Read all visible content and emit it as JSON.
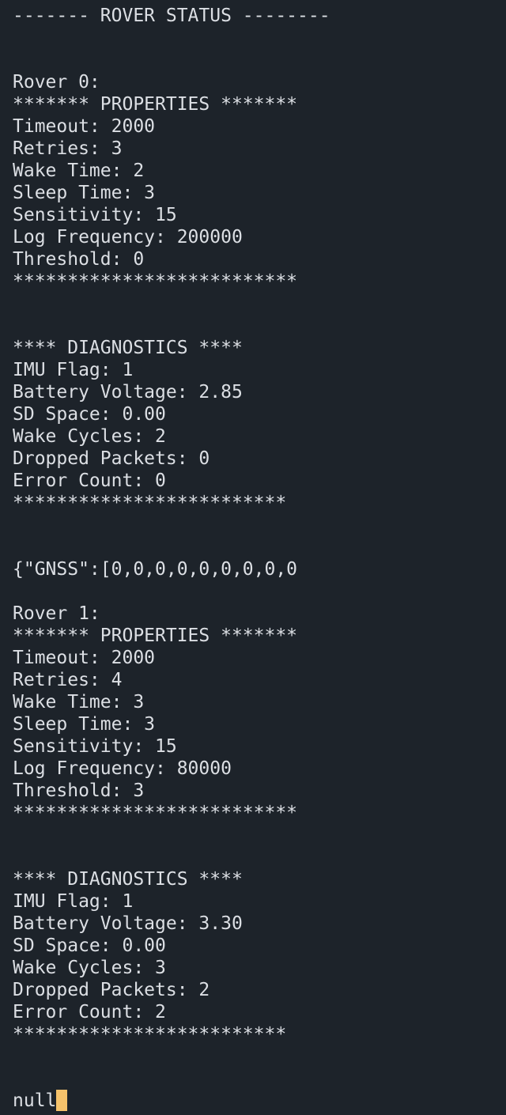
{
  "terminal": {
    "lines": [
      "------- ROVER STATUS --------",
      "",
      "",
      "Rover 0:",
      "******* PROPERTIES *******",
      "Timeout: 2000",
      "Retries: 3",
      "Wake Time: 2",
      "Sleep Time: 3",
      "Sensitivity: 15",
      "Log Frequency: 200000",
      "Threshold: 0",
      "**************************",
      "",
      "",
      "**** DIAGNOSTICS ****",
      "IMU Flag: 1",
      "Battery Voltage: 2.85",
      "SD Space: 0.00",
      "Wake Cycles: 2",
      "Dropped Packets: 0",
      "Error Count: 0",
      "*************************",
      "",
      "",
      "{\"GNSS\":[0,0,0,0,0,0,0,0,0",
      "",
      "Rover 1:",
      "******* PROPERTIES *******",
      "Timeout: 2000",
      "Retries: 4",
      "Wake Time: 3",
      "Sleep Time: 3",
      "Sensitivity: 15",
      "Log Frequency: 80000",
      "Threshold: 3",
      "**************************",
      "",
      "",
      "**** DIAGNOSTICS ****",
      "IMU Flag: 1",
      "Battery Voltage: 3.30",
      "SD Space: 0.00",
      "Wake Cycles: 3",
      "Dropped Packets: 2",
      "Error Count: 2",
      "*************************",
      "",
      "",
      "null"
    ],
    "colors": {
      "background": "#1d232a",
      "text": "#dcdfe4",
      "cursor": "#f5c26b"
    }
  }
}
